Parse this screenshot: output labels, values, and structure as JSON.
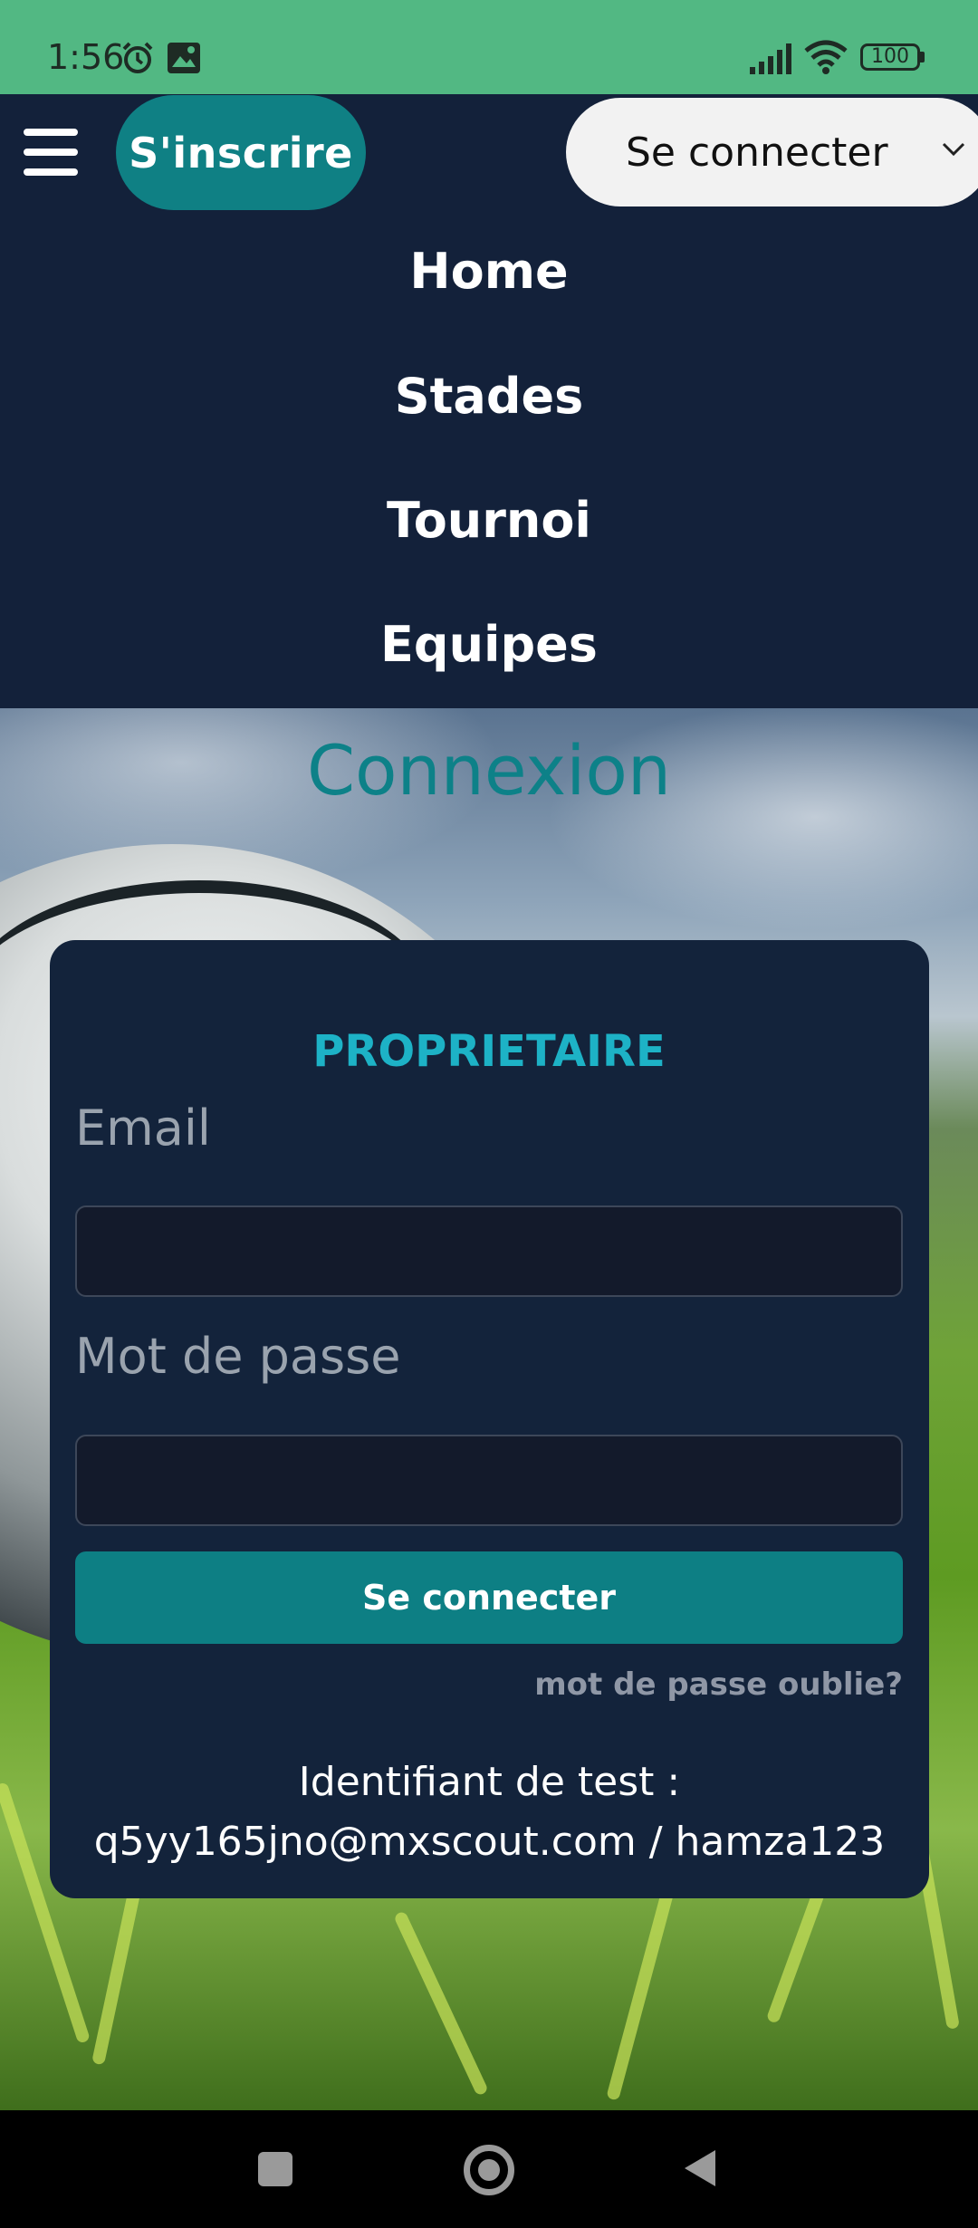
{
  "status_bar": {
    "time": "1:56",
    "battery": "100",
    "icons": [
      "alarm-icon",
      "photo-notification-icon",
      "signal-icon",
      "wifi-icon",
      "battery-icon"
    ]
  },
  "header": {
    "menu_icon": "hamburger-icon",
    "signup_label": "S'inscrire",
    "login_select_label": "Se connecter",
    "nav_items": [
      "Home",
      "Stades",
      "Tournoi",
      "Equipes"
    ]
  },
  "page": {
    "title": "Connexion"
  },
  "login_form": {
    "role": "PROPRIETAIRE",
    "email_label": "Email",
    "email_value": "",
    "password_label": "Mot de passe",
    "password_value": "",
    "submit_label": "Se connecter",
    "forgot_link": "mot de passe oublie?",
    "test_caption": "Identifiant de test :",
    "test_credentials": "q5yy165jno@mxscout.com / hamza123"
  },
  "system_nav": {
    "buttons": [
      "recents-button",
      "home-button",
      "back-button"
    ]
  },
  "colors": {
    "status_bar": "#52b883",
    "header_bg": "#13213a",
    "accent": "#0f8084",
    "role_text": "#1db2c6",
    "card_bg": "#13233b"
  }
}
